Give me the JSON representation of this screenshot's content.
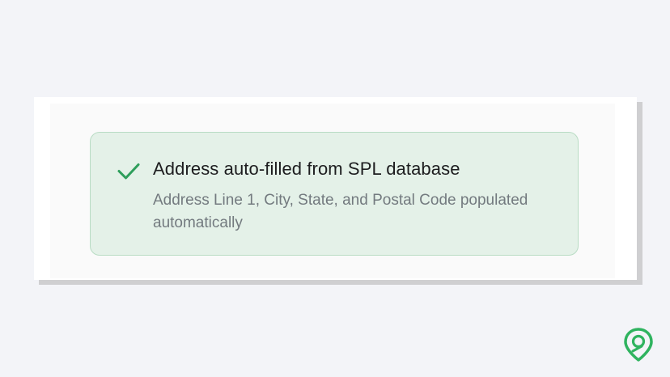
{
  "banner": {
    "title": "Address auto-filled from SPL database",
    "description": "Address Line 1, City, State, and Postal Code populated automatically",
    "icon": "check-icon",
    "colors": {
      "background": "#e4f1e8",
      "border": "#b9dcc4",
      "check": "#2e9e5b"
    }
  },
  "logo": {
    "icon": "location-pin-logo",
    "color": "#2fb35f"
  }
}
